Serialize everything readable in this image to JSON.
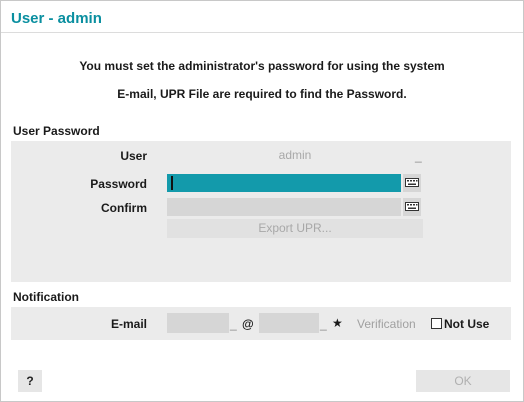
{
  "dialog": {
    "title": "User - admin",
    "message_line1": "You must set the administrator's password for using the system",
    "message_line2": "E-mail, UPR File are required to find the Password."
  },
  "user_password": {
    "section_title": "User Password",
    "user_label": "User",
    "user_value": "admin",
    "user_underscore": "_",
    "password_label": "Password",
    "password_value": "",
    "confirm_label": "Confirm",
    "confirm_value": "",
    "export_label": "Export UPR...",
    "keyboard_icon": "keyboard-icon",
    "accent_color": "#139aab"
  },
  "notification": {
    "section_title": "Notification",
    "email_label": "E-mail",
    "email_user_underscore": "_",
    "at_symbol": "@",
    "email_domain_underscore": "_",
    "star_glyph": "★",
    "verification_label": "Verification",
    "not_use_label": "Not Use"
  },
  "footer": {
    "help_label": "?",
    "ok_label": "OK"
  }
}
